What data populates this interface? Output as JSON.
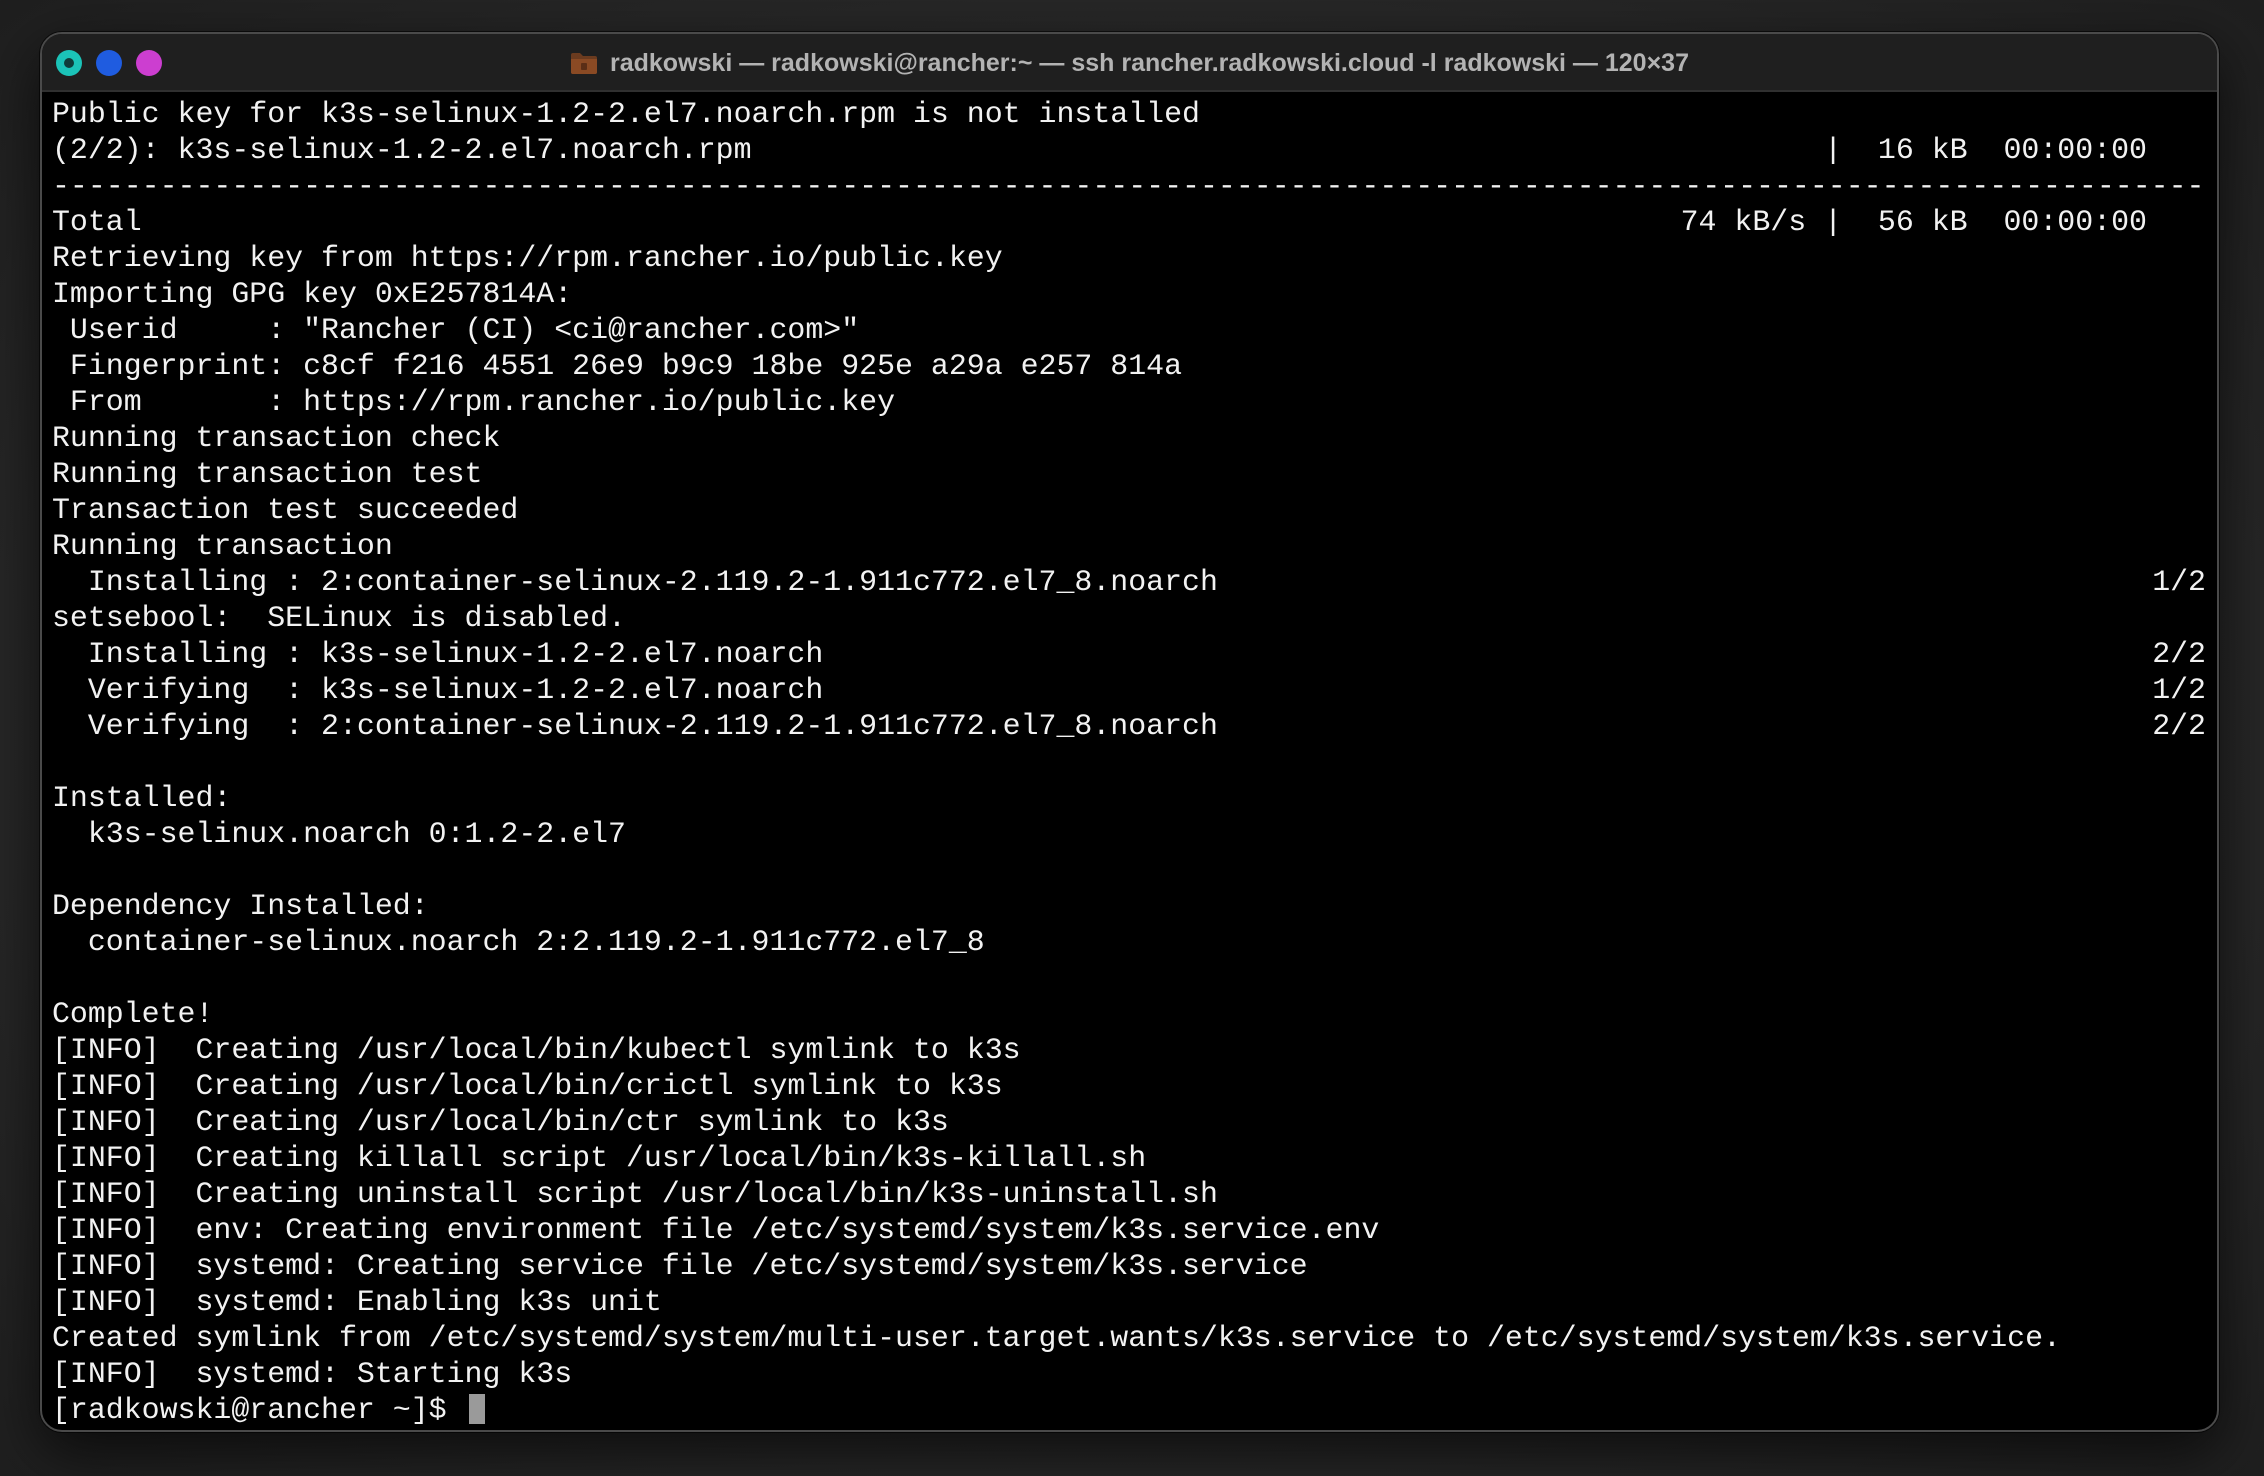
{
  "window": {
    "title": "radkowski — radkowski@rancher:~ — ssh rancher.radkowski.cloud -l radkowski — 120×37",
    "title_icon": "folder-icon",
    "buttons": {
      "close": "close-button",
      "minimize": "minimize-button",
      "maximize": "maximize-button"
    },
    "colors": {
      "close": "#1bc3b8",
      "minimize": "#1f5ce0",
      "maximize": "#cc3ed0",
      "background": "#000000",
      "text": "#f2f2f2"
    }
  },
  "terminal": {
    "lines": [
      "Public key for k3s-selinux-1.2-2.el7.noarch.rpm is not installed",
      "(2/2): k3s-selinux-1.2-2.el7.noarch.rpm",
      "",
      "Total",
      "Retrieving key from https://rpm.rancher.io/public.key",
      "Importing GPG key 0xE257814A:",
      " Userid     : \"Rancher (CI) <ci@rancher.com>\"",
      " Fingerprint: c8cf f216 4551 26e9 b9c9 18be 925e a29a e257 814a",
      " From       : https://rpm.rancher.io/public.key",
      "Running transaction check",
      "Running transaction test",
      "Transaction test succeeded",
      "Running transaction",
      "  Installing : 2:container-selinux-2.119.2-1.911c772.el7_8.noarch",
      "setsebool:  SELinux is disabled.",
      "  Installing : k3s-selinux-1.2-2.el7.noarch",
      "  Verifying  : k3s-selinux-1.2-2.el7.noarch",
      "  Verifying  : 2:container-selinux-2.119.2-1.911c772.el7_8.noarch",
      "",
      "Installed:",
      "  k3s-selinux.noarch 0:1.2-2.el7",
      "",
      "Dependency Installed:",
      "  container-selinux.noarch 2:2.119.2-1.911c772.el7_8",
      "",
      "Complete!",
      "[INFO]  Creating /usr/local/bin/kubectl symlink to k3s",
      "[INFO]  Creating /usr/local/bin/crictl symlink to k3s",
      "[INFO]  Creating /usr/local/bin/ctr symlink to k3s",
      "[INFO]  Creating killall script /usr/local/bin/k3s-killall.sh",
      "[INFO]  Creating uninstall script /usr/local/bin/k3s-uninstall.sh",
      "[INFO]  env: Creating environment file /etc/systemd/system/k3s.service.env",
      "[INFO]  systemd: Creating service file /etc/systemd/system/k3s.service",
      "[INFO]  systemd: Enabling k3s unit",
      "Created symlink from /etc/systemd/system/multi-user.target.wants/k3s.service to /etc/systemd/system/k3s.service.",
      "[INFO]  systemd: Starting k3s",
      "[radkowski@rancher ~]$ "
    ],
    "separator": "-------------------------------------------------------------------------------------------------------------------------",
    "download_right": "|  16 kB  00:00:00",
    "total_right": "74 kB/s |  56 kB  00:00:00",
    "progress": {
      "step1": "1/2",
      "step2": "2/2",
      "step3": "1/2",
      "step4": "2/2"
    }
  }
}
